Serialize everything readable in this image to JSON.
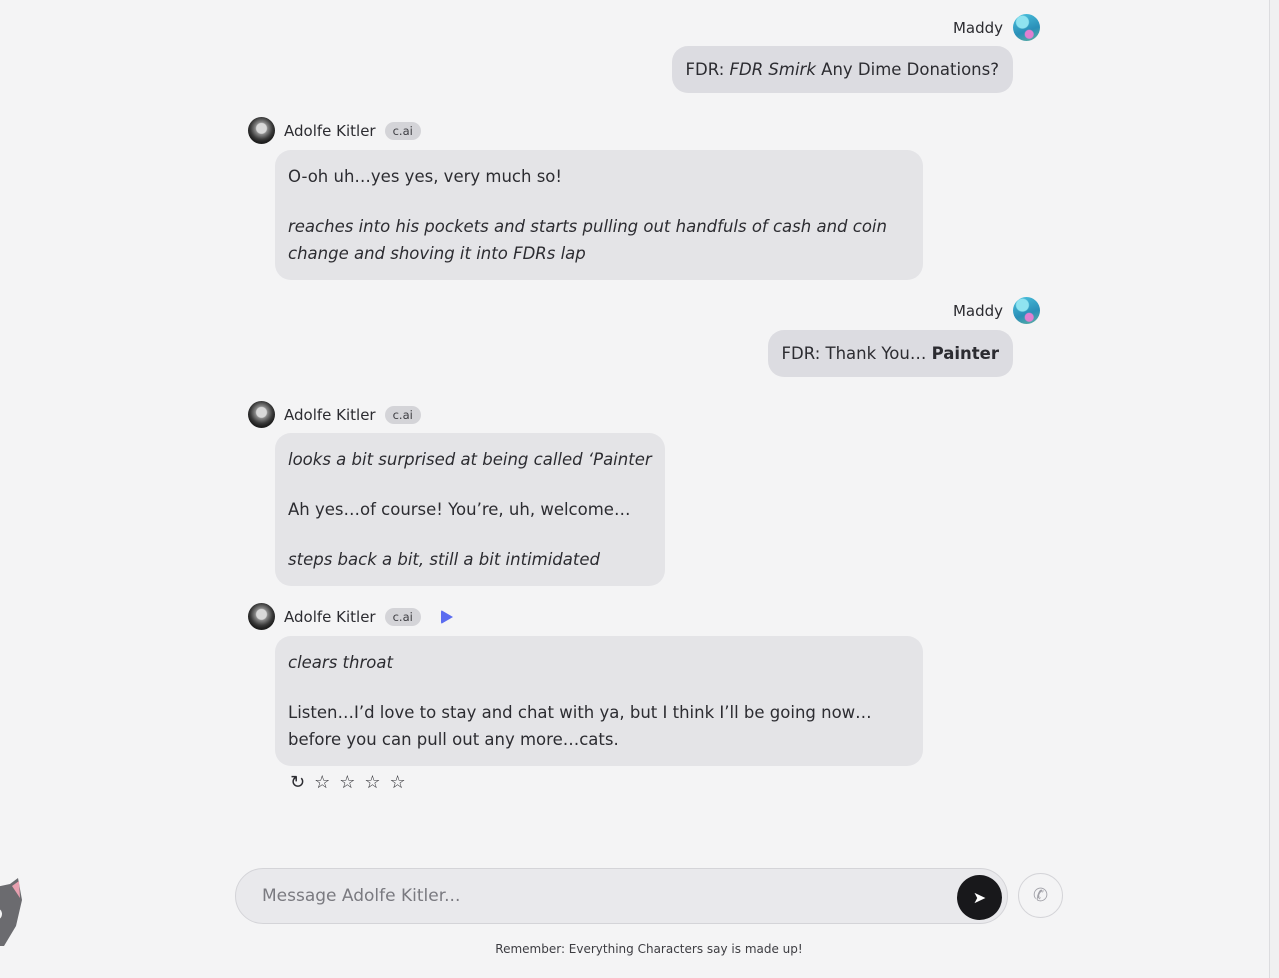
{
  "messages": [
    {
      "type": "user",
      "author": "Maddy",
      "prefix": "FDR: ",
      "emphasis": "FDR Smirk",
      "suffix": " Any Dime Donations?"
    },
    {
      "type": "char",
      "author": "Adolfe Kitler",
      "badge": "c.ai",
      "line1": "O-oh uh…yes yes, very much so!",
      "line2": "reaches into his pockets and starts pulling out handfuls of cash and coin change and shoving it into FDRs lap"
    },
    {
      "type": "user",
      "author": "Maddy",
      "prefix": "FDR: Thank You… ",
      "strong": "Painter"
    },
    {
      "type": "char",
      "author": "Adolfe Kitler",
      "badge": "c.ai",
      "line1": "looks a bit surprised at being called ‘Painter",
      "line2": "Ah yes…of course! You’re, uh, welcome…",
      "line3": "steps back a bit, still a bit intimidated"
    },
    {
      "type": "char",
      "author": "Adolfe Kitler",
      "badge": "c.ai",
      "line1": "clears throat",
      "line2": "Listen…I’d love to stay and chat with ya, but I think I’ll be going now… before you can pull out any more…cats."
    }
  ],
  "actions": {
    "refresh_icon": "refresh-icon",
    "star_icon": "star-outline-icon",
    "rating_max": 4
  },
  "composer": {
    "placeholder": "Message Adolfe Kitler...",
    "send_icon": "send-icon",
    "call_icon": "phone-icon"
  },
  "disclaimer": "Remember: Everything Characters say is made up!",
  "colors": {
    "background": "#f4f4f5",
    "user_bubble": "#dcdce1",
    "char_bubble": "#e4e4e7",
    "play_accent": "#5b6cf0"
  }
}
